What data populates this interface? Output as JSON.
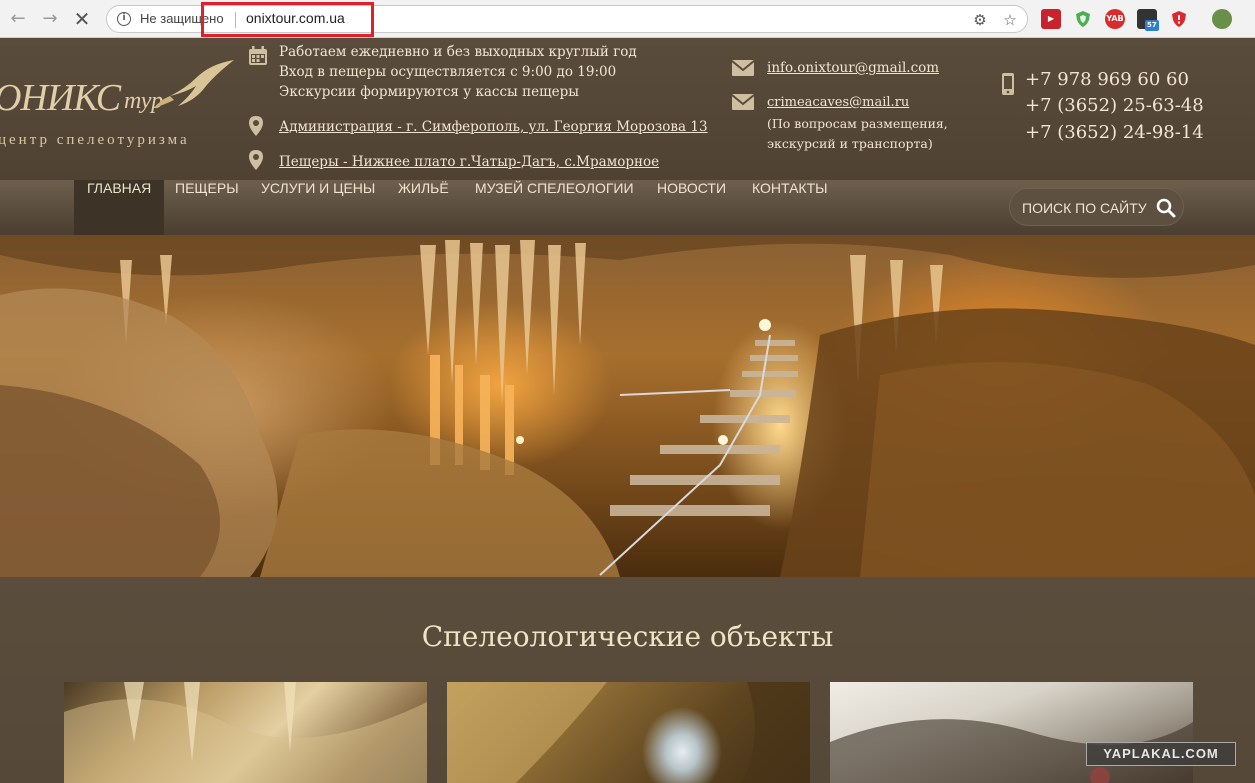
{
  "browser": {
    "security_label": "Не защищено",
    "url": "onixtour.com.ua",
    "extensions": [
      "video-ext-icon",
      "shield-ext-icon",
      "yab-ext-icon",
      "spy-ext-icon",
      "adblock-ext-icon",
      "profile-avatar"
    ],
    "ext_badge_yab": "YAB",
    "ext_badge_count": "57"
  },
  "header": {
    "logo_main": "ОНИКС",
    "logo_tur": "тур",
    "logo_sub": "центр спелеотуризма",
    "schedule": [
      "Работаем ежедневно и без выходных круглый год",
      "Вход в пещеры осуществляется с 9:00 до 19:00",
      "Экскурсии формируются у кассы пещеры"
    ],
    "address_admin": "Администрация - г. Симферополь, ул. Георгия Морозова 13",
    "address_caves": "Пещеры - Нижнее плато г.Чатыр-Дагъ, с.Мраморное",
    "email_1": "info.onixtour@gmail.com",
    "email_2": "crimeacaves@mail.ru",
    "email_2_note_1": "(По вопросам размещения,",
    "email_2_note_2": "экскурсий и транспорта)",
    "phones": [
      "+7 978 969 60 60",
      "+7 (3652) 25-63-48",
      "+7 (3652) 24-98-14"
    ]
  },
  "nav": {
    "items": [
      "ГЛАВНАЯ",
      "ПЕЩЕРЫ",
      "УСЛУГИ И ЦЕНЫ",
      "ЖИЛЬЁ",
      "МУЗЕЙ СПЕЛЕОЛОГИИ",
      "НОВОСТИ",
      "КОНТАКТЫ"
    ],
    "active_index": 0,
    "search_label": "ПОИСК ПО САЙТУ"
  },
  "main": {
    "section_title": "Спелеологические объекты"
  },
  "watermark": "YAPLAKAL.COM",
  "colors": {
    "header_bg": "#5a4c3b",
    "nav_active_bg": "#3d3327",
    "text_light": "#efe6d2",
    "highlight_red": "#e0202a"
  }
}
